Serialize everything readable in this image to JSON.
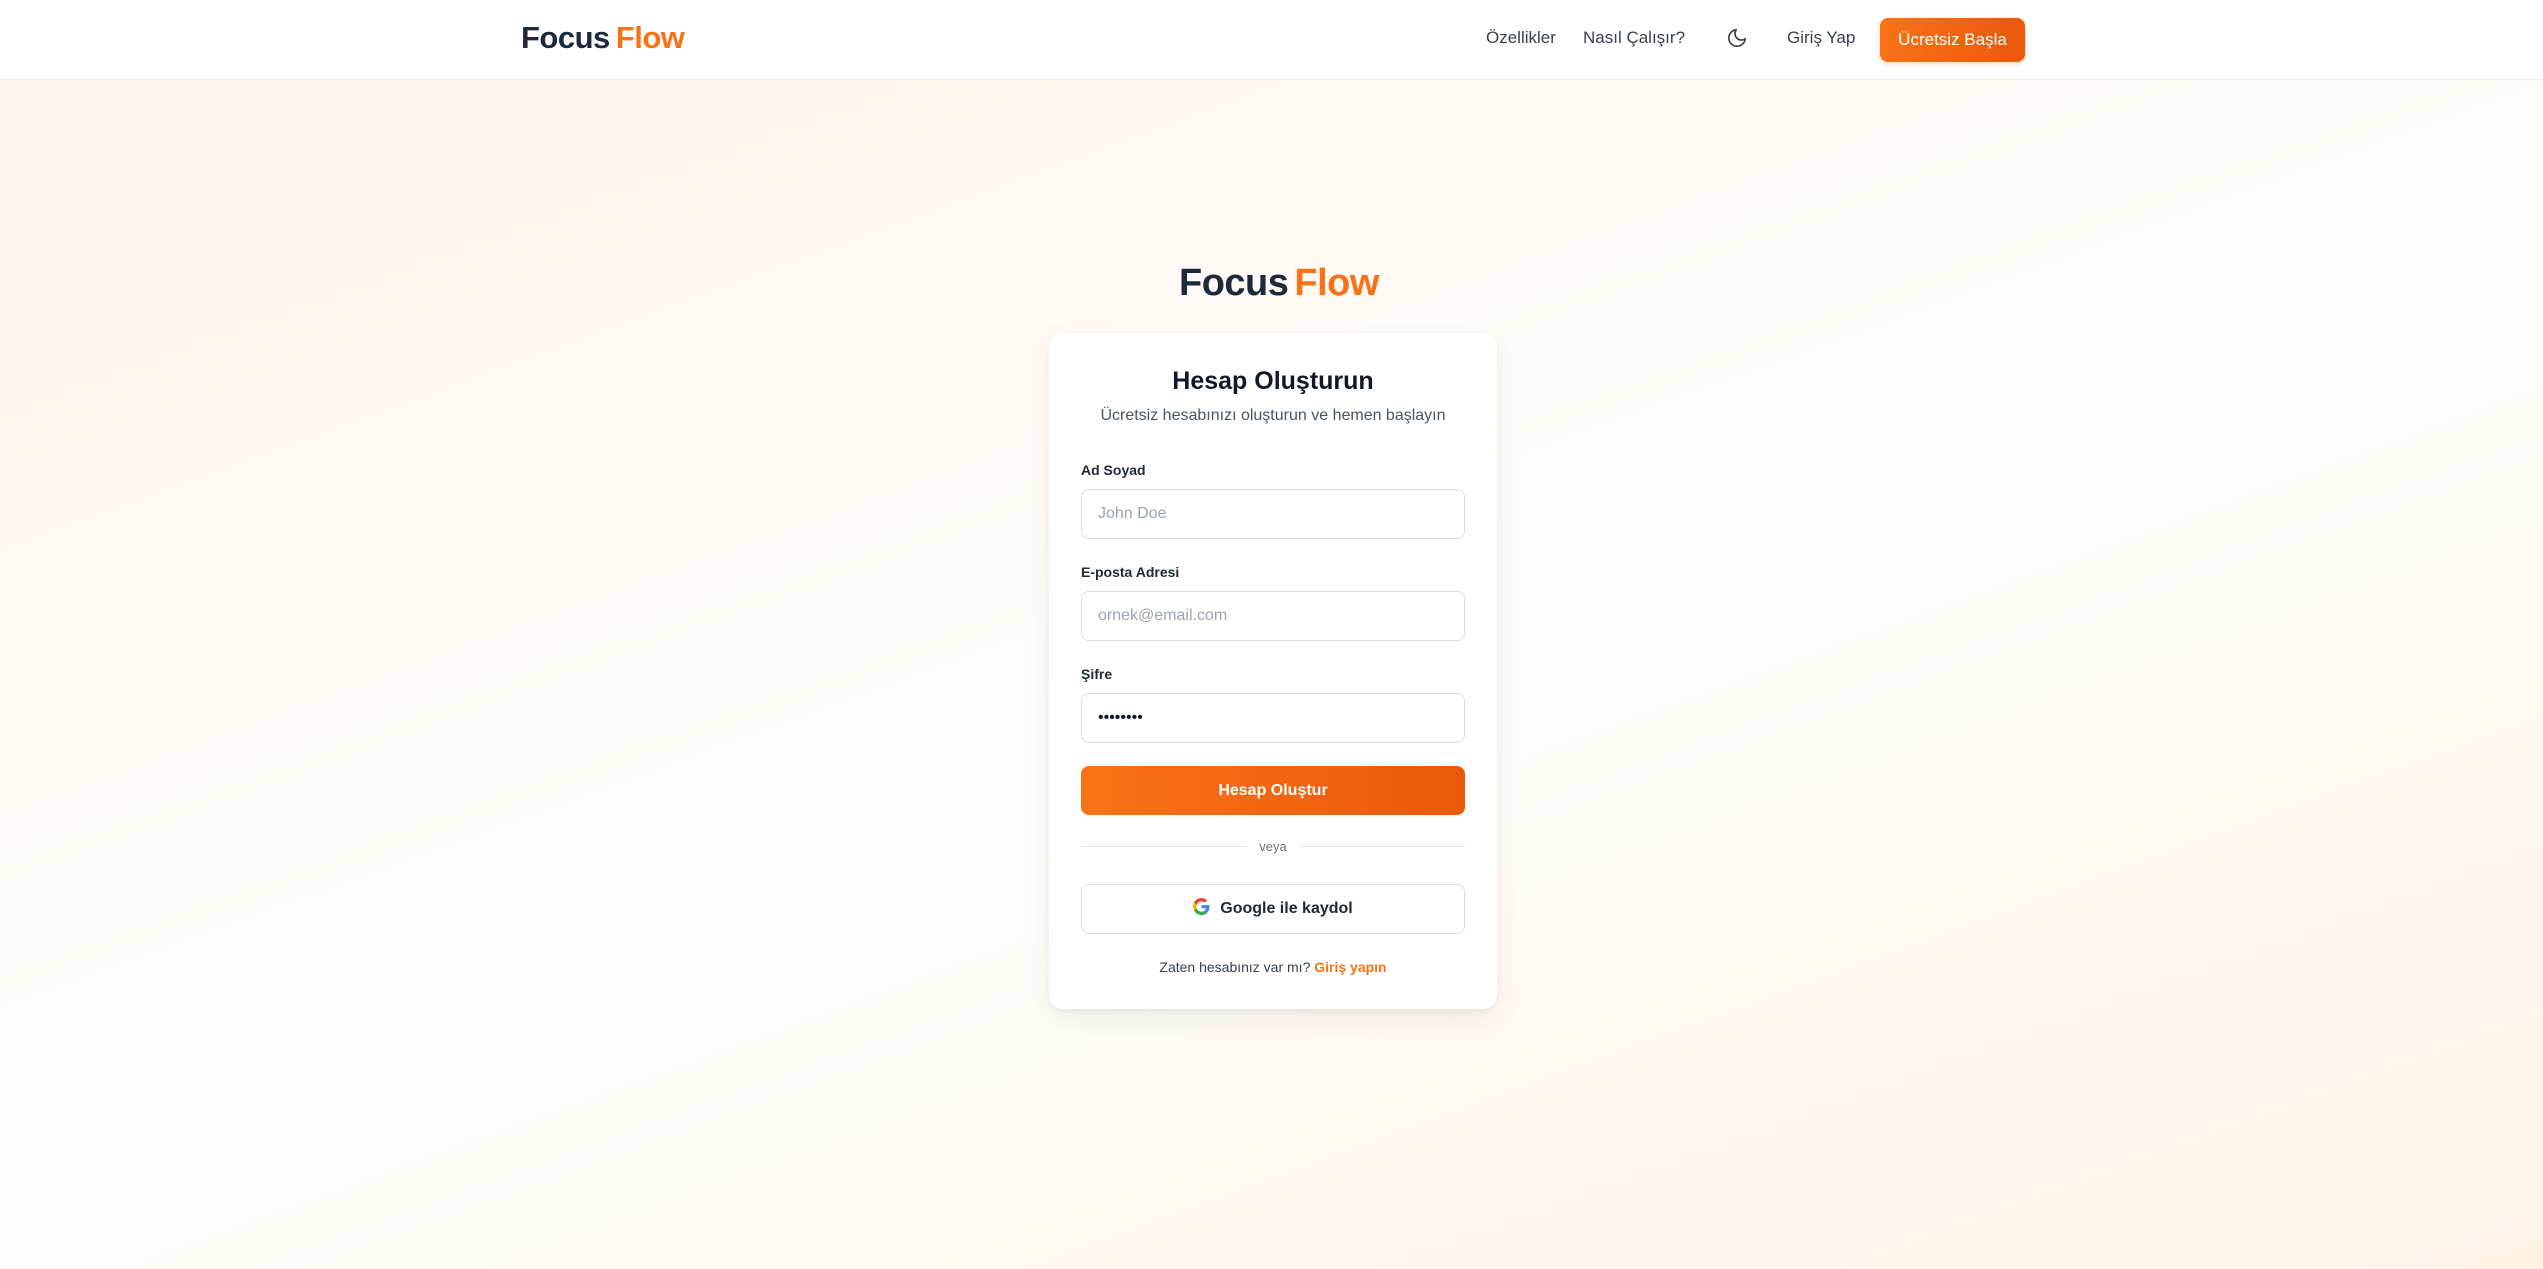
{
  "navbar": {
    "logo_part1": "Focus",
    "logo_part2": "Flow",
    "features_label": "Özellikler",
    "how_label": "Nasıl Çalışır?",
    "theme_icon": "moon-icon",
    "login_label": "Giriş Yap",
    "cta_label": "Ücretsiz Başla"
  },
  "brand": {
    "logo_part1": "Focus",
    "logo_part2": "Flow"
  },
  "form": {
    "title": "Hesap Oluşturun",
    "subtitle": "Ücretsiz hesabınızı oluşturun ve hemen başlayın",
    "name_label": "Ad Soyad",
    "name_placeholder": "John Doe",
    "email_label": "E-posta Adresi",
    "email_placeholder": "ornek@email.com",
    "password_label": "Şifre",
    "password_value": "********",
    "submit_label": "Hesap Oluştur",
    "divider_text": "veya",
    "google_label": "Google ile kaydol",
    "google_icon": "google-icon",
    "footer_text": "Zaten hesabınız var mı?",
    "footer_link": "Giriş yapın"
  },
  "colors": {
    "accent": "#f97316",
    "accent_dark": "#ea580c",
    "text_dark": "#1e293b"
  }
}
